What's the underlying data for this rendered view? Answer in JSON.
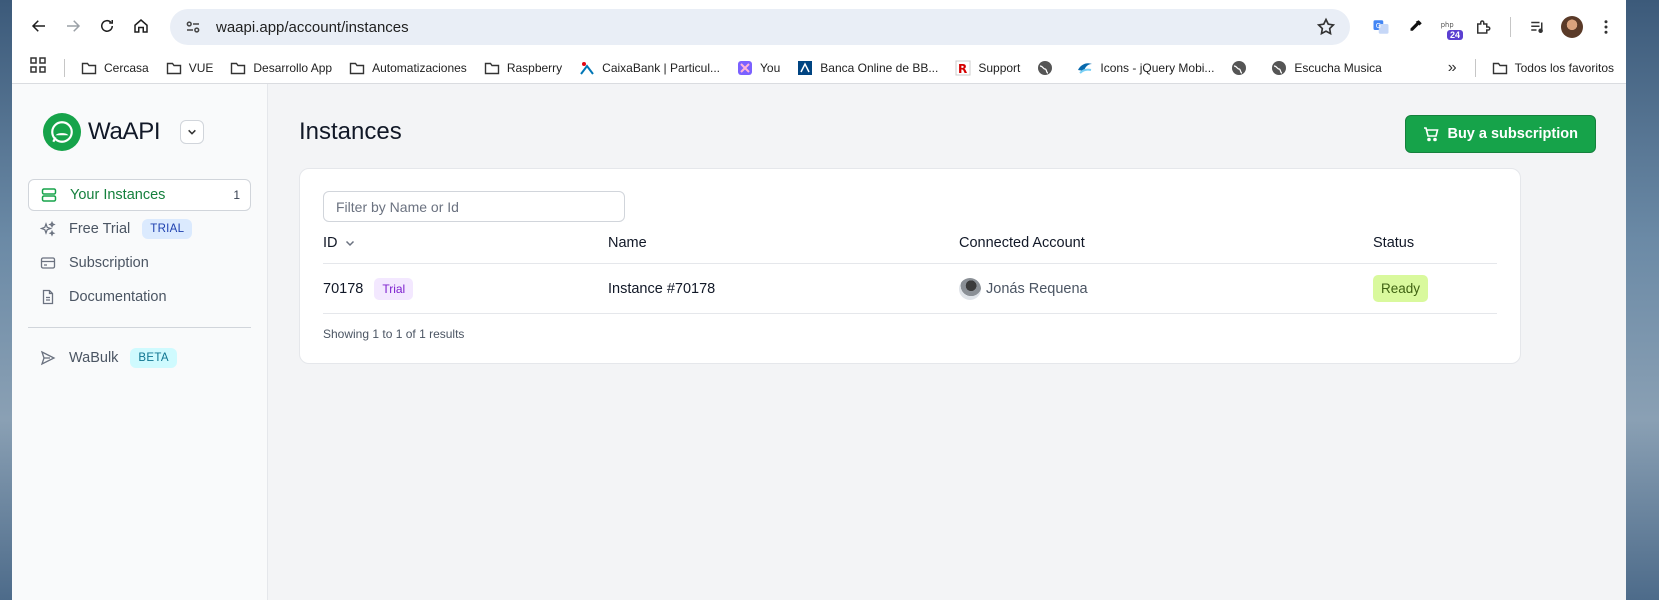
{
  "browser": {
    "url": "waapi.app/account/instances",
    "profile_badge": "24"
  },
  "bookmarks": {
    "items": [
      {
        "label": "Cercasa",
        "icon": "folder-icon"
      },
      {
        "label": "VUE",
        "icon": "folder-icon"
      },
      {
        "label": "Desarrollo App",
        "icon": "folder-icon"
      },
      {
        "label": "Automatizaciones",
        "icon": "folder-icon"
      },
      {
        "label": "Raspberry",
        "icon": "folder-icon"
      },
      {
        "label": "CaixaBank | Particul...",
        "icon": "caixabank-icon"
      },
      {
        "label": "You",
        "icon": "you-icon"
      },
      {
        "label": "Banca Online de BB...",
        "icon": "bbva-icon"
      },
      {
        "label": "Support",
        "icon": "support-icon"
      },
      {
        "label": "",
        "icon": "globe-icon"
      },
      {
        "label": "Icons - jQuery Mobi...",
        "icon": "jquery-icon"
      },
      {
        "label": "",
        "icon": "globe-icon"
      },
      {
        "label": "Escucha Musica",
        "icon": "globe-icon"
      }
    ],
    "all_label": "Todos los favoritos"
  },
  "sidebar": {
    "brand": "WaAPI",
    "items": [
      {
        "label": "Your Instances",
        "count": "1"
      },
      {
        "label": "Free Trial",
        "tag": "TRIAL"
      },
      {
        "label": "Subscription"
      },
      {
        "label": "Documentation"
      },
      {
        "label": "WaBulk",
        "tag": "BETA"
      }
    ]
  },
  "main": {
    "title": "Instances",
    "buy_label": "Buy a subscription",
    "filter_placeholder": "Filter by Name or Id",
    "columns": [
      "ID",
      "Name",
      "Connected Account",
      "Status"
    ],
    "rows": [
      {
        "id": "70178",
        "tag": "Trial",
        "name": "Instance #70178",
        "account": "Jonás Requena",
        "status": "Ready"
      }
    ],
    "showing": "Showing 1 to 1 of 1 results"
  },
  "colors": {
    "brand_green": "#16a34a",
    "ready_bg": "#d9f99d",
    "trial_bg": "#f3e8ff"
  }
}
